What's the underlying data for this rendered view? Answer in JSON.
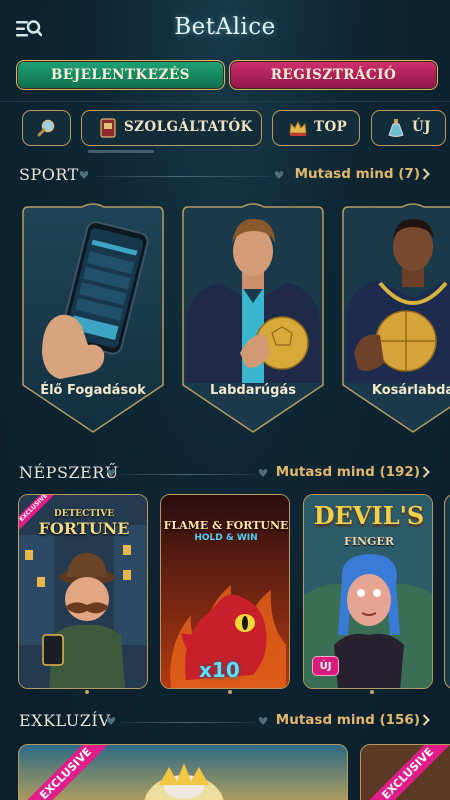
{
  "header": {
    "logo_text": "BetAlice",
    "login_label": "BEJELENTKEZÉS",
    "register_label": "REGISZTRÁCIÓ"
  },
  "categories": [
    {
      "label": "",
      "icon": "magnifier-icon"
    },
    {
      "label": "SZOLGÁLTATÓK",
      "icon": "book-icon"
    },
    {
      "label": "TOP",
      "icon": "crown-icon"
    },
    {
      "label": "ÚJ",
      "icon": "potion-icon"
    }
  ],
  "sections": {
    "sport": {
      "title": "SPORT",
      "see_all": "Mutasd mind (7)"
    },
    "popular": {
      "title": "NÉPSZERŰ",
      "see_all": "Mutasd mind (192)"
    },
    "exclusive": {
      "title": "EXKLUZÍV",
      "see_all": "Mutasd mind (156)"
    }
  },
  "sport_cards": [
    {
      "label": "Élő Fogadások"
    },
    {
      "label": "Labdarúgás"
    },
    {
      "label": "Kosárlabda"
    }
  ],
  "games": [
    {
      "title_line1": "DETECTIVE",
      "title_line2": "FORTUNE",
      "badge": "EXCLUSIVE"
    },
    {
      "title_line1": "FLAME & FORTUNE",
      "title_line2": "HOLD & WIN",
      "multiplier": "x10"
    },
    {
      "title_line1": "DEVIL'S",
      "title_line2": "FINGER",
      "badge_new": "ÚJ"
    }
  ],
  "exclusive_cards": [
    {
      "badge": "EXCLUSIVE"
    },
    {
      "badge": "EXCLUSIVE"
    }
  ],
  "colors": {
    "background": "#0d2431",
    "gold": "#d9b56a",
    "login_green": "#1fa278",
    "register_magenta": "#c22a66",
    "accent_link": "#e2b66c",
    "exclusive_pink": "#e21c88"
  }
}
